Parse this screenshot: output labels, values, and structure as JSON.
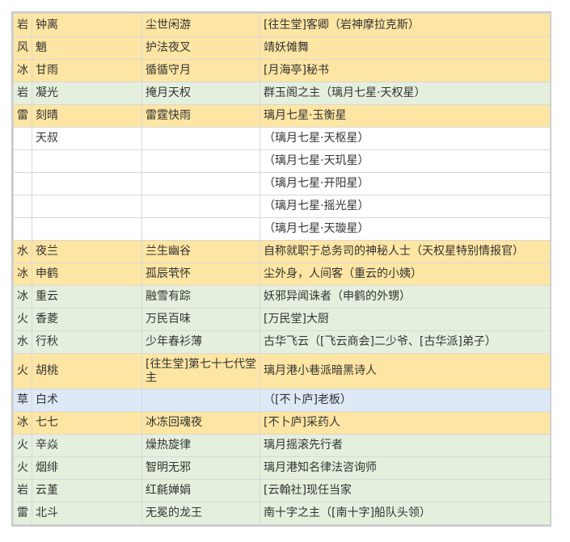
{
  "colors": {
    "yellow": "#fde5a3",
    "green": "#e4f0dd",
    "blue": "#dde9f6",
    "white": "#ffffff"
  },
  "rows": [
    {
      "element": "岩",
      "name": "钟离",
      "title": "尘世闲游",
      "description": "[往生堂]客卿（岩神摩拉克斯）",
      "bg": "yellow"
    },
    {
      "element": "风",
      "name": "魈",
      "title": "护法夜叉",
      "description": "靖妖傩舞",
      "bg": "yellow"
    },
    {
      "element": "冰",
      "name": "甘雨",
      "title": "循循守月",
      "description": "[月海亭]秘书",
      "bg": "yellow"
    },
    {
      "element": "岩",
      "name": "凝光",
      "title": "掩月天权",
      "description": "群玉阁之主（璃月七星·天权星）",
      "bg": "green"
    },
    {
      "element": "雷",
      "name": "刻晴",
      "title": "雷霆快雨",
      "description": "璃月七星·玉衡星",
      "bg": "yellow"
    },
    {
      "element": "",
      "name": "天叔",
      "title": "",
      "description": "（璃月七星·天枢星）",
      "bg": "white"
    },
    {
      "element": "",
      "name": "",
      "title": "",
      "description": "（璃月七星·天玑星）",
      "bg": "white"
    },
    {
      "element": "",
      "name": "",
      "title": "",
      "description": "（璃月七星·开阳星）",
      "bg": "white"
    },
    {
      "element": "",
      "name": "",
      "title": "",
      "description": "（璃月七星·摇光星）",
      "bg": "white"
    },
    {
      "element": "",
      "name": "",
      "title": "",
      "description": "（璃月七星·天璇星）",
      "bg": "white"
    },
    {
      "element": "水",
      "name": "夜兰",
      "title": "兰生幽谷",
      "description": "自称就职于总务司的神秘人士（天权星特别情报官）",
      "bg": "yellow"
    },
    {
      "element": "冰",
      "name": "申鹤",
      "title": "孤辰茕怀",
      "description": "尘外身，人间客（重云的小姨）",
      "bg": "yellow"
    },
    {
      "element": "冰",
      "name": "重云",
      "title": "融雪有踪",
      "description": "妖邪异闻诛者（申鹤的外甥）",
      "bg": "green"
    },
    {
      "element": "火",
      "name": "香菱",
      "title": "万民百味",
      "description": "[万民堂]大厨",
      "bg": "green"
    },
    {
      "element": "水",
      "name": "行秋",
      "title": "少年春衫薄",
      "description": "古华飞云（[飞云商会]二少爷、[古华派]弟子）",
      "bg": "green"
    },
    {
      "element": "火",
      "name": "胡桃",
      "title": "[往生堂]第七十七代堂主",
      "description": "璃月港小巷派暗黑诗人",
      "bg": "yellow",
      "tall": true
    },
    {
      "element": "草",
      "name": "白术",
      "title": "",
      "description": "（[不卜庐]老板）",
      "bg": "blue"
    },
    {
      "element": "冰",
      "name": "七七",
      "title": "冰冻回魂夜",
      "description": "[不卜庐]采药人",
      "bg": "yellow"
    },
    {
      "element": "火",
      "name": "辛焱",
      "title": "燥热旋律",
      "description": "璃月摇滚先行者",
      "bg": "green"
    },
    {
      "element": "火",
      "name": "烟绯",
      "title": "智明无邪",
      "description": "璃月港知名律法咨询师",
      "bg": "green"
    },
    {
      "element": "岩",
      "name": "云堇",
      "title": "红毹婵娟",
      "description": "[云翰社]现任当家",
      "bg": "green"
    },
    {
      "element": "雷",
      "name": "北斗",
      "title": "无冕的龙王",
      "description": "南十字之主（[南十字]船队头领）",
      "bg": "green"
    }
  ]
}
